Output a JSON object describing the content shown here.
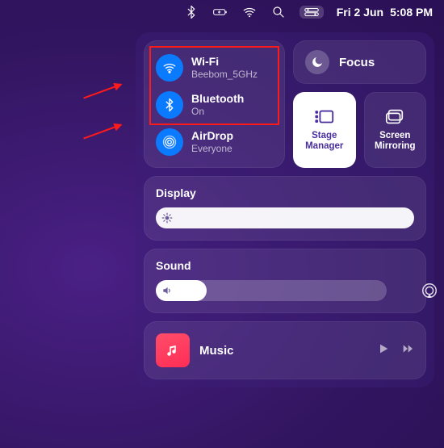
{
  "menubar": {
    "date": "Fri 2 Jun",
    "time": "5:08 PM"
  },
  "connectivity": {
    "wifi": {
      "title": "Wi-Fi",
      "sub": "Beebom_5GHz"
    },
    "bluetooth": {
      "title": "Bluetooth",
      "sub": "On"
    },
    "airdrop": {
      "title": "AirDrop",
      "sub": "Everyone"
    }
  },
  "focus": {
    "label": "Focus"
  },
  "tiles": {
    "stage": {
      "label": "Stage Manager",
      "active": true
    },
    "mirror": {
      "label": "Screen Mirroring",
      "active": false
    }
  },
  "display": {
    "label": "Display",
    "value_pct": 98
  },
  "sound": {
    "label": "Sound",
    "value_pct": 22
  },
  "music": {
    "label": "Music"
  }
}
